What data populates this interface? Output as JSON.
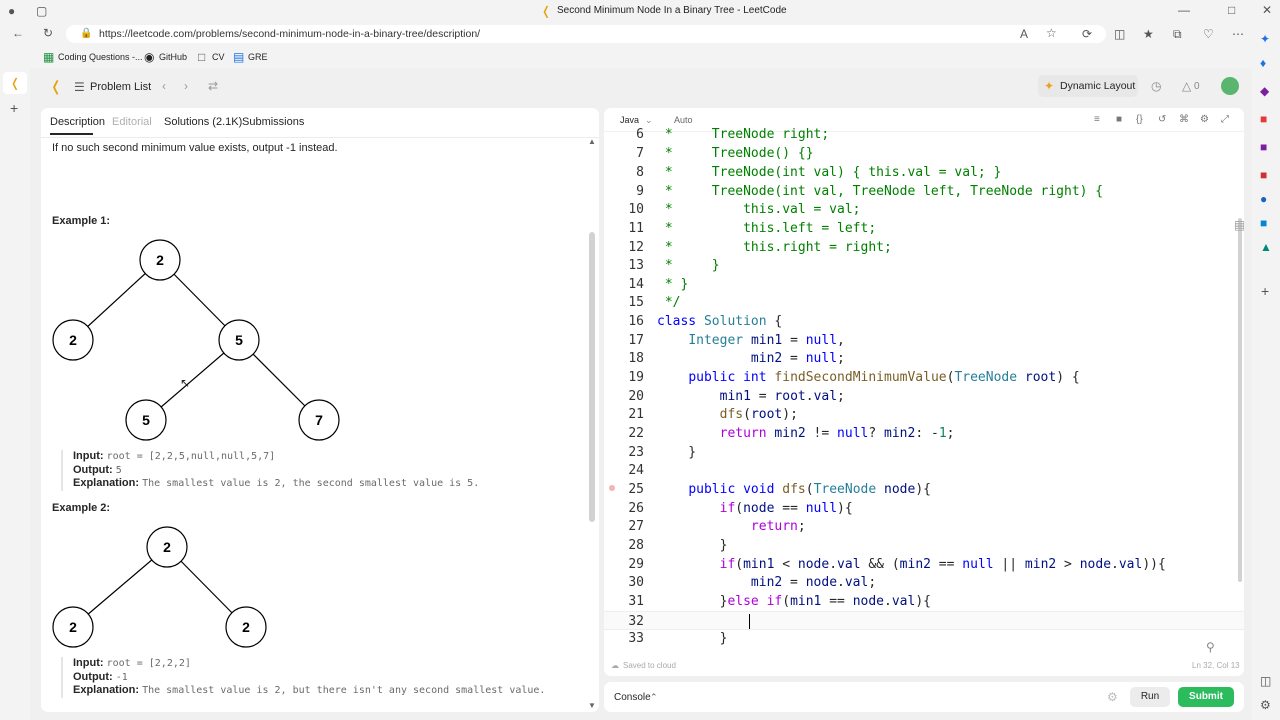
{
  "browser": {
    "tab_title": "Second Minimum Node In a Binary Tree - LeetCode",
    "url": "https://leetcode.com/problems/second-minimum-node-in-a-binary-tree/description/",
    "bookmarks": [
      "Coding Questions -...",
      "GitHub",
      "CV",
      "GRE"
    ]
  },
  "header": {
    "problem_list": "Problem List",
    "dynamic_layout": "Dynamic Layout",
    "streak_count": "0"
  },
  "tabs": {
    "description": "Description",
    "editorial": "Editorial",
    "solutions": "Solutions (2.1K)",
    "submissions": "Submissions"
  },
  "description": {
    "intro": "If no such second minimum value exists, output -1 instead.",
    "example1": {
      "title": "Example 1:",
      "tree": [
        "2",
        "2",
        "5",
        "5",
        "7"
      ],
      "input_label": "Input:",
      "input": "root = [2,2,5,null,null,5,7]",
      "output_label": "Output:",
      "output": "5",
      "explanation_label": "Explanation:",
      "explanation": "The smallest value is 2, the second smallest value is 5."
    },
    "example2": {
      "title": "Example 2:",
      "tree": [
        "2",
        "2",
        "2"
      ],
      "input_label": "Input:",
      "input": "root = [2,2,2]",
      "output_label": "Output:",
      "output": "-1",
      "explanation_label": "Explanation:",
      "explanation": "The smallest value is 2, but there isn't any second smallest value."
    }
  },
  "editor": {
    "language": "Java",
    "mode": "Auto",
    "status": "Saved to cloud",
    "cursor_pos": "Ln 32, Col 13",
    "line_numbers": [
      "6",
      "7",
      "8",
      "9",
      "10",
      "11",
      "12",
      "13",
      "14",
      "15",
      "16",
      "17",
      "18",
      "19",
      "20",
      "21",
      "22",
      "23",
      "24",
      "25",
      "26",
      "27",
      "28",
      "29",
      "30",
      "31",
      "32",
      "33"
    ]
  },
  "console": {
    "label": "Console",
    "run": "Run",
    "submit": "Submit"
  },
  "colors": {
    "submit_green": "#2cbb5d",
    "comment_green": "#008000",
    "keyword_blue": "#0000ff"
  }
}
